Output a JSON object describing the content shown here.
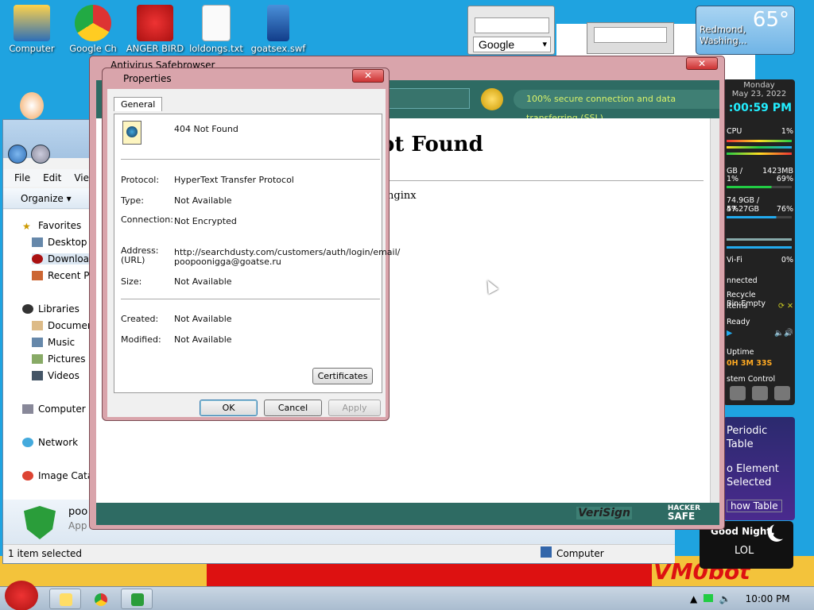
{
  "desktop_icons": [
    {
      "label": "Computer"
    },
    {
      "label": "Google Ch"
    },
    {
      "label": "ANGER BIRD"
    },
    {
      "label": "loldongs.txt"
    },
    {
      "label": "goatsex.swf"
    }
  ],
  "search_gadget": {
    "engine": "Google"
  },
  "weather": {
    "temp": "65°",
    "location": "Redmond, Washing..."
  },
  "sidebar": {
    "day": "Monday",
    "date": "May 23, 2022",
    "time": ":00:59 PM",
    "cpu_label": "CPU",
    "cpu_val": "1%",
    "ram_a": "GB /",
    "ram_b": "1423MB",
    "ram_c": "1%",
    "ram_d": "69%",
    "disk_a": "74.9GB / 57.27GB",
    "disk_b": "4%",
    "disk_c": "76%",
    "wifi_label": "Vi-Fi",
    "wifi_val": "0%",
    "connected": "nnected",
    "recycle": "Recycle Bin:Empty",
    "recycle_items": "items",
    "ready": "Ready",
    "uptime_label": "Uptime",
    "uptime_val": "0H 3M 33S",
    "system_control": "stem Control"
  },
  "periodic": {
    "l1": "Periodic",
    "l2": "Table",
    "l3": "o Element",
    "l4": "Selected",
    "l5": "how Table"
  },
  "goodnight": {
    "line1": "Good Night,",
    "line2": "LOL"
  },
  "explorer": {
    "menu": [
      "File",
      "Edit",
      "View"
    ],
    "organize": "Organize",
    "favorites": "Favorites",
    "desktop": "Desktop",
    "downloads": "Download",
    "recent": "Recent Pl",
    "libraries": "Libraries",
    "documents": "Documen",
    "music": "Music",
    "pictures": "Pictures",
    "videos": "Videos",
    "computer": "Computer",
    "network": "Network",
    "image_catalog": "Image Cata",
    "details_name": "poo",
    "details_type": "App",
    "status": "1 item selected",
    "status_location": "Computer"
  },
  "antivirus": {
    "title": "Antivirus Safebrowser",
    "ssl_text": "100% secure connection and data transferring (SSL)",
    "heading": "ot Found",
    "server": "nginx",
    "verisign": "VeriSign",
    "hacker_top": "HACKER",
    "hacker_bottom": "SAFE"
  },
  "properties": {
    "title": "Properties",
    "tab": "General",
    "file_name": "404 Not Found",
    "protocol_label": "Protocol:",
    "protocol_value": "HyperText Transfer Protocol",
    "type_label": "Type:",
    "type_value": "Not Available",
    "connection_label": "Connection:",
    "connection_value": "Not Encrypted",
    "address_label": "Address:",
    "url_label": "(URL)",
    "address_line1": "http://searchdusty.com/customers/auth/login/email/",
    "address_line2": "poopoonigga@goatse.ru",
    "size_label": "Size:",
    "size_value": "Not Available",
    "created_label": "Created:",
    "created_value": "Not Available",
    "modified_label": "Modified:",
    "modified_value": "Not Available",
    "certificates": "Certificates",
    "ok": "OK",
    "cancel": "Cancel",
    "apply": "Apply"
  },
  "taskbar": {
    "clock": "10:00 PM"
  },
  "wallpaper": {
    "brand": "VM0bot"
  }
}
